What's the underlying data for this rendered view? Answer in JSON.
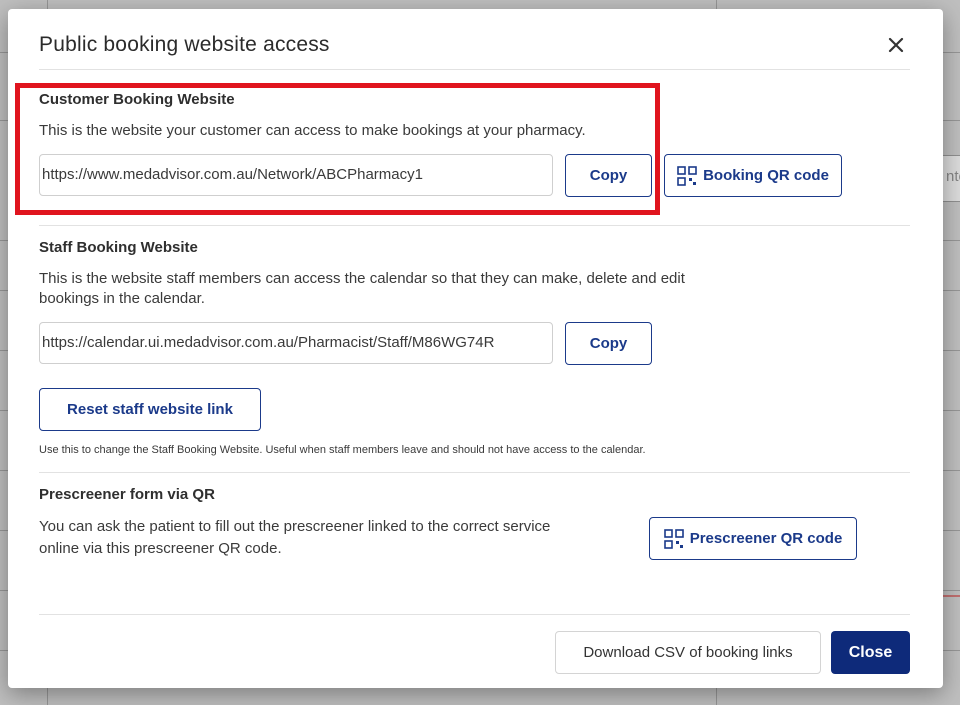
{
  "dialog": {
    "title": "Public booking website access",
    "close_icon": "close-icon"
  },
  "customer": {
    "heading": "Customer Booking Website",
    "description": "This is the website your customer can access to make bookings at your pharmacy.",
    "url": "https://www.medadvisor.com.au/Network/ABCPharmacy1",
    "copy_label": "Copy",
    "qr_label": "Booking QR code",
    "qr_icon": "qr-code-icon"
  },
  "staff": {
    "heading": "Staff Booking Website",
    "description_line1": "This is the website staff members can access the calendar so that they can make, delete and edit",
    "description_line2": "bookings in the calendar.",
    "url": "https://calendar.ui.medadvisor.com.au/Pharmacist/Staff/M86WG74R",
    "copy_label": "Copy",
    "reset_label": "Reset staff website link",
    "reset_note": "Use this to change the Staff Booking Website. Useful when staff members leave and should not have access to the calendar."
  },
  "prescreener": {
    "heading": "Prescreener form via QR",
    "description_line1": "You can ask the patient to fill out the prescreener linked to the correct service",
    "description_line2": "online via this prescreener QR code.",
    "qr_label": "Prescreener QR code",
    "qr_icon": "qr-code-icon"
  },
  "footer": {
    "download_label": "Download CSV of booking links",
    "close_label": "Close"
  },
  "background": {
    "partial_text": "nte"
  },
  "colors": {
    "primary": "#0e2a7a",
    "outline": "#1b3a8a",
    "highlight": "#e0141e"
  }
}
